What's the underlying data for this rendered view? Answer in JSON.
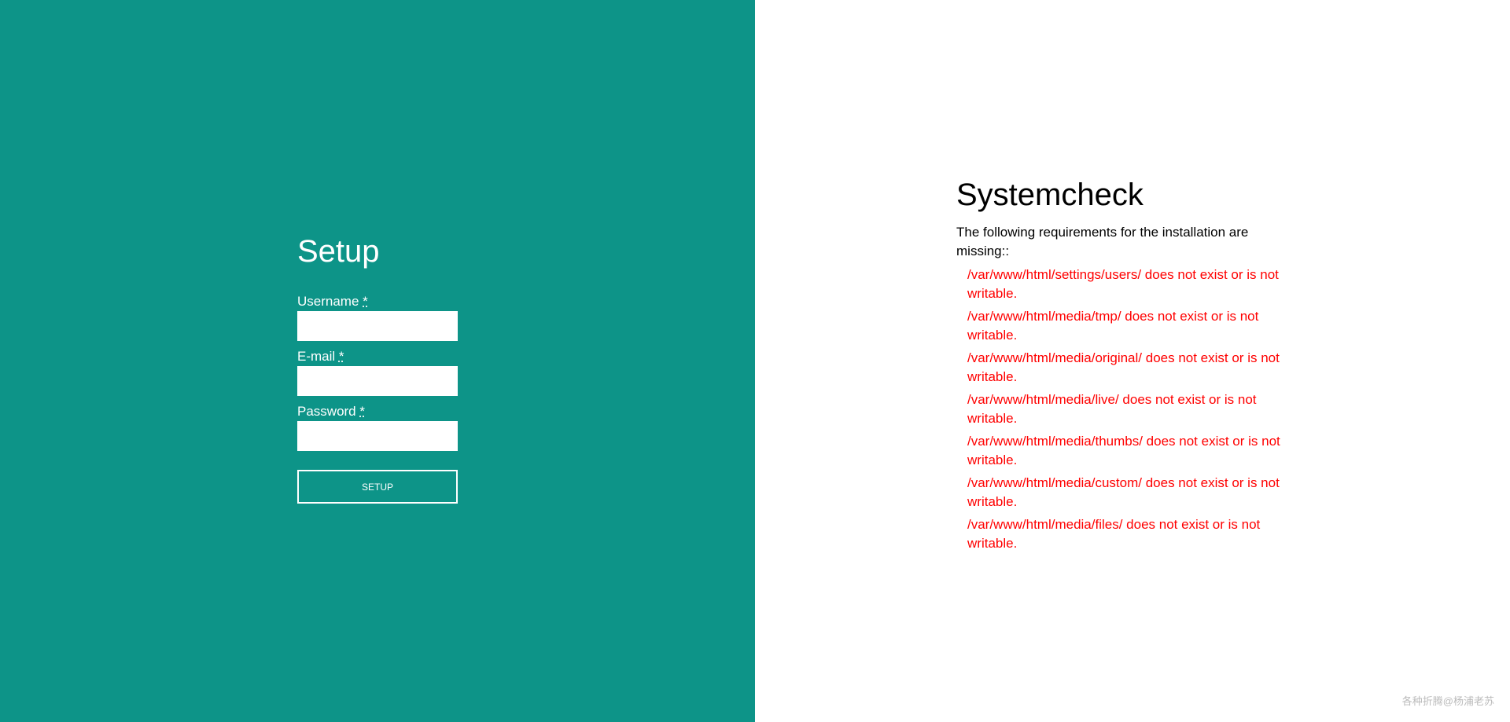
{
  "setup": {
    "title": "Setup",
    "fields": [
      {
        "label": "Username",
        "required_mark": "*",
        "value": ""
      },
      {
        "label": "E-mail",
        "required_mark": "*",
        "value": ""
      },
      {
        "label": "Password",
        "required_mark": "*",
        "value": ""
      }
    ],
    "button_label": "SETUP"
  },
  "systemcheck": {
    "title": "Systemcheck",
    "intro": "The following requirements for the installation are missing::",
    "errors": [
      "/var/www/html/settings/users/ does not exist or is not writable.",
      "/var/www/html/media/tmp/ does not exist or is not writable.",
      "/var/www/html/media/original/ does not exist or is not writable.",
      "/var/www/html/media/live/ does not exist or is not writable.",
      "/var/www/html/media/thumbs/ does not exist or is not writable.",
      "/var/www/html/media/custom/ does not exist or is not writable.",
      "/var/www/html/media/files/ does not exist or is not writable."
    ]
  },
  "watermark": "各种折腾@杨浦老苏",
  "colors": {
    "panel_bg": "#0d9488",
    "error_text": "#ff0000"
  }
}
